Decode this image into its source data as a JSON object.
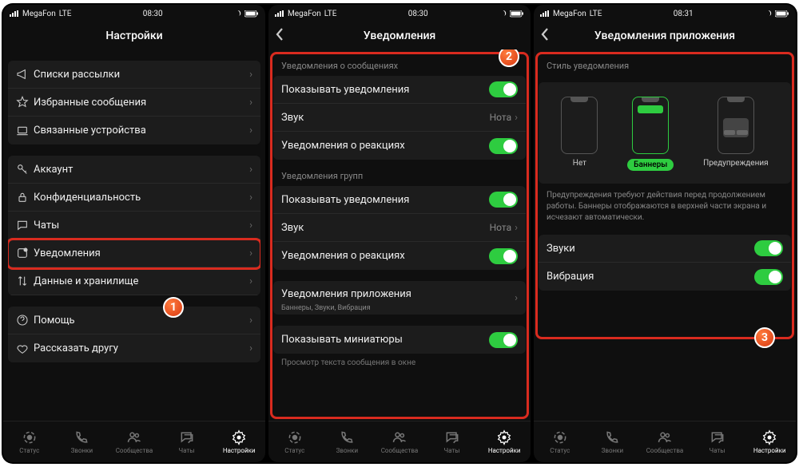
{
  "status": {
    "carrier": "MegaFon",
    "net": "LTE",
    "time1": "08:30",
    "time2": "08:31"
  },
  "p1": {
    "title": "Настройки",
    "g1": {
      "a": "Списки рассылки",
      "b": "Избранные сообщения",
      "c": "Связанные устройства"
    },
    "g2": {
      "a": "Аккаунт",
      "b": "Конфиденциальность",
      "c": "Чаты",
      "d": "Уведомления",
      "e": "Данные и хранилище"
    },
    "g3": {
      "a": "Помощь",
      "b": "Рассказать другу"
    }
  },
  "p2": {
    "title": "Уведомления",
    "s1": "Уведомления о сообщениях",
    "s1a": "Показывать уведомления",
    "s1b": "Звук",
    "s1bv": "Нота",
    "s1c": "Уведомления о реакциях",
    "s2": "Уведомления групп",
    "s2a": "Показывать уведомления",
    "s2b": "Звук",
    "s2bv": "Нота",
    "s2c": "Уведомления о реакциях",
    "app": "Уведомления приложения",
    "appsub": "Баннеры, Звуки, Вибрация",
    "thumb": "Показывать миниатюры",
    "foot": "Просмотр текста сообщения в окне"
  },
  "p3": {
    "title": "Уведомления приложения",
    "sh": "Стиль уведомления",
    "o1": "Нет",
    "o2": "Баннеры",
    "o3": "Предупреждения",
    "hint": "Предупреждения требуют действия перед продолжением работы. Баннеры отображаются в верхней части экрана и исчезают автоматически.",
    "r1": "Звуки",
    "r2": "Вибрация"
  },
  "tabs": {
    "a": "Статус",
    "b": "Звонки",
    "c": "Сообщества",
    "d": "Чаты",
    "e": "Настройки"
  },
  "badges": {
    "b1": "1",
    "b2": "2",
    "b3": "3"
  }
}
